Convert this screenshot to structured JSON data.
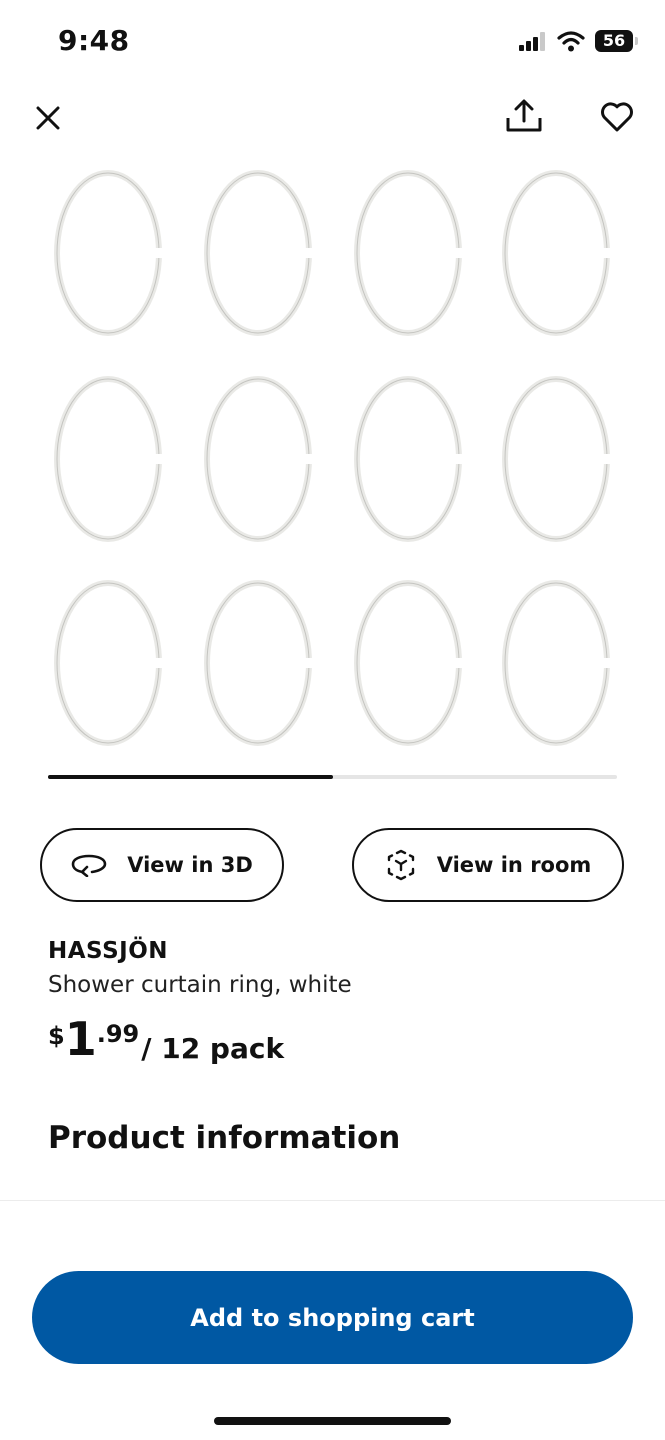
{
  "status_bar": {
    "time": "9:48",
    "battery_level": "56",
    "icons": [
      "cellular-signal-icon",
      "wifi-icon",
      "battery-icon"
    ]
  },
  "top_bar": {
    "icons": [
      "close-icon",
      "share-icon",
      "heart-icon"
    ]
  },
  "gallery": {
    "image_subject": "shower-curtain-rings",
    "ring_count": 12,
    "carousel_progress": 0.5
  },
  "actions": {
    "view_3d_label": "View in 3D",
    "view_room_label": "View in room"
  },
  "product": {
    "name": "HASSJÖN",
    "description": "Shower curtain ring, white",
    "price": {
      "currency": "$",
      "integer": "1",
      "decimal": ".99",
      "unit": "/ 12 pack"
    }
  },
  "section": {
    "title": "Product information"
  },
  "cart": {
    "button_label": "Add to shopping cart"
  },
  "colors": {
    "primary_button": "#0058a3",
    "text": "#111111",
    "progress_track": "#e5e5e5"
  }
}
